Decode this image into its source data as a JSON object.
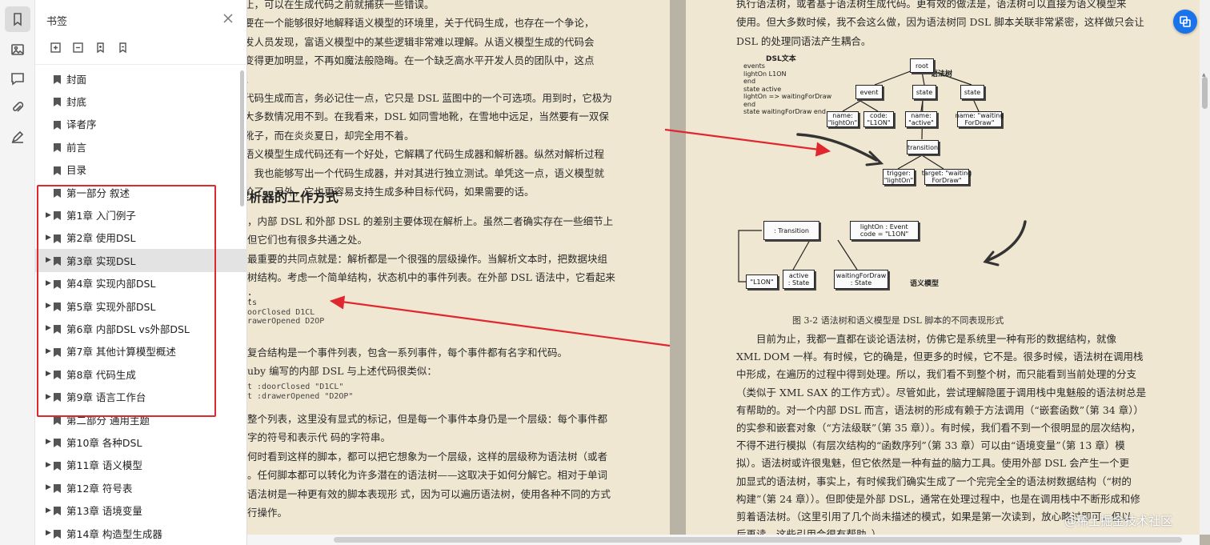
{
  "panel": {
    "title": "书签",
    "items": [
      {
        "label": "封面",
        "expandable": false
      },
      {
        "label": "封底",
        "expandable": false
      },
      {
        "label": "译者序",
        "expandable": false
      },
      {
        "label": "前言",
        "expandable": false
      },
      {
        "label": "目录",
        "expandable": false
      },
      {
        "label": "第一部分 叙述",
        "expandable": false
      },
      {
        "label": "第1章 入门例子",
        "expandable": true
      },
      {
        "label": "第2章 使用DSL",
        "expandable": true
      },
      {
        "label": "第3章 实现DSL",
        "expandable": true,
        "selected": true
      },
      {
        "label": "第4章 实现内部DSL",
        "expandable": true
      },
      {
        "label": "第5章 实现外部DSL",
        "expandable": true
      },
      {
        "label": "第6章 内部DSL vs外部DSL",
        "expandable": true
      },
      {
        "label": "第7章 其他计算模型概述",
        "expandable": true
      },
      {
        "label": "第8章 代码生成",
        "expandable": true
      },
      {
        "label": "第9章 语言工作台",
        "expandable": true
      },
      {
        "label": "第二部分 通用主题",
        "expandable": false
      },
      {
        "label": "第10章 各种DSL",
        "expandable": true
      },
      {
        "label": "第11章 语义模型",
        "expandable": true
      },
      {
        "label": "第12章 符号表",
        "expandable": true
      },
      {
        "label": "第13章 语境变量",
        "expandable": true
      },
      {
        "label": "第14章 构造型生成器",
        "expandable": true
      }
    ]
  },
  "left_page": {
    "lines_top": [
      "止，可以在生成代码之前就捕获一些错误。",
      "要在一个能够很好地解释语义模型的环境里，关于代码生成，也存在一个争论，",
      "发人员发现，富语义模型中的某些逻辑非常难以理解。从语义模型生成的代码会",
      "变得更加明显，不再如魔法般隐晦。在一个缺乏高水平开发人员的团队中，这点",
      "。",
      "代码生成而言，务必记住一点，它只是 DSL 蓝图中的一个可选项。用到时，它极为",
      "大多数情况用不到。在我看来，DSL 如同雪地靴，在雪地中远足，当然要有一双保",
      "靴子，而在炎炎夏日，却完全用不着。",
      "语义模型生成代码还有一个好处，它解耦了代码生成器和解析器。纵然对解析过程",
      "，我也能够写出一个代码生成器，并对其进行独立测试。单凭这一点，语义模型就",
      "价了。另外，它也更容易支持生成多种目标代码，如果需要的话。"
    ],
    "heading": "解析器的工作方式",
    "lines_mid": [
      "，内部 DSL 和外部 DSL 的差别主要体现在解析上。虽然二者确实存在一些细节上",
      "但它们也有很多共通之处。",
      "最重要的共同点就是：解析都是一个很强的层级操作。当解析文本时，把数据块组",
      "树结构。考虑一个简单结构，状态机中的事件列表。在外部 DSL 语法中，它看起来",
      "："
    ],
    "code1": [
      "ts",
      "oorClosed D1CL",
      "rawerOpened D2OP"
    ],
    "lines_after_code1": [
      "复合结构是一个事件列表，包含一系列事件，每个事件都有名字和代码。",
      "uby 编写的内部 DSL 与上述代码很类似："
    ],
    "code2": [
      "t :doorClosed \"D1CL\"",
      "t :drawerOpened \"D2OP\""
    ],
    "lines_bottom": [
      "整个列表，这里没有显式的标记，但是每一个事件本身仍是一个层级：每个事件都",
      "字的符号和表示代 码的字符串。",
      "何时看到这样的脚本，都可以把它想象为一个层级，这样的层级称为语法树（或者",
      "。任何脚本都可以转化为许多潜在的语法树——这取决于如何分解它。相对于单词",
      "语法树是一种更有效的脚本表现形 式，因为可以遍历语法树，使用各种不同的方式",
      "行操作。"
    ]
  },
  "right_page": {
    "lines_top": [
      "执行语法树，或者基于语法树生成代码。更有效的做法是，语法树可以直接为语义模型来",
      "使用。但大多数时候，我不会这么做，因为语法树同 DSL 脚本关联非常紧密，这样做只会让",
      "DSL 的处理同语法产生耦合。"
    ],
    "diagram": {
      "dsl_title": "DSL文本",
      "dsl_lines": [
        "events",
        " lightOn L1ON",
        "end",
        "state active",
        " lightOn => waitingForDraw",
        "end",
        "state waitingForDraw end"
      ],
      "tree_label": "语法树",
      "model_label": "语义模型",
      "tree_nodes": {
        "root": "root",
        "event": "event",
        "state1": "state",
        "state2": "state",
        "name_lighton": "name:\n\"lightOn\"",
        "code_l1on": "code:\n\"L1ON\"",
        "name_active": "name:\n\"active\"",
        "name_waiting": "name: \"waiting\nForDraw\"",
        "transition": "transition",
        "trigger": "trigger:\n\"lightOn\"",
        "target": "target: \"waiting\nForDraw\""
      },
      "model_nodes": {
        "transition": ": Transition",
        "event": "lightOn : Event\ncode = \"L1ON\"",
        "l1on": "\"L1ON\"",
        "active": "active\n: State",
        "waiting": "waitingForDraw\n: State"
      }
    },
    "caption": "图 3-2    语法树和语义模型是 DSL 脚本的不同表现形式",
    "lines_bottom": [
      "目前为止，我都一直都在谈论语法树，仿佛它是系统里一种有形的数据结构，就像",
      "XML DOM 一样。有时候，它的确是，但更多的时候，它不是。很多时候，语法树在调用栈",
      "中形成，在遍历的过程中得到处理。所以，我们看不到整个树，而只能看到当前处理的分支",
      "（类似于 XML SAX 的工作方式）。尽管如此，尝试理解隐匿于调用栈中鬼魅般的语法树总是",
      "有帮助的。对一个内部 DSL 而言，语法树的形成有赖于方法调用（“嵌套函数”（第 34 章））",
      "的实参和嵌套对象（“方法级联”（第 35 章））。有时候，我们看不到一个很明显的层次结构，",
      "不得不进行模拟（有层次结构的“函数序列”（第 33 章）可以由“语境变量”（第 13 章）模",
      "拟）。语法树或许很鬼魅，但它依然是一种有益的脑力工具。使用外部 DSL 会产生一个更",
      "加显式的语法树，事实上，有时候我们确实生成了一个完完全全的语法树数据结构（“树的",
      "构建”（第 24 章））。但即使是外部 DSL，通常在处理过程中，也是在调用栈中不断形成和修",
      "剪着语法树。（这里引用了几个尚未描述的模式，如果是第一次读到，放心略过即可，但以",
      "后再读，这些引用会很有帮助。）"
    ]
  },
  "watermark": "@稀土掘金技术社区",
  "colors": {
    "annotation_red": "#e0262e",
    "page_bg": "#efe7d1",
    "accent_blue": "#1a73e8"
  }
}
